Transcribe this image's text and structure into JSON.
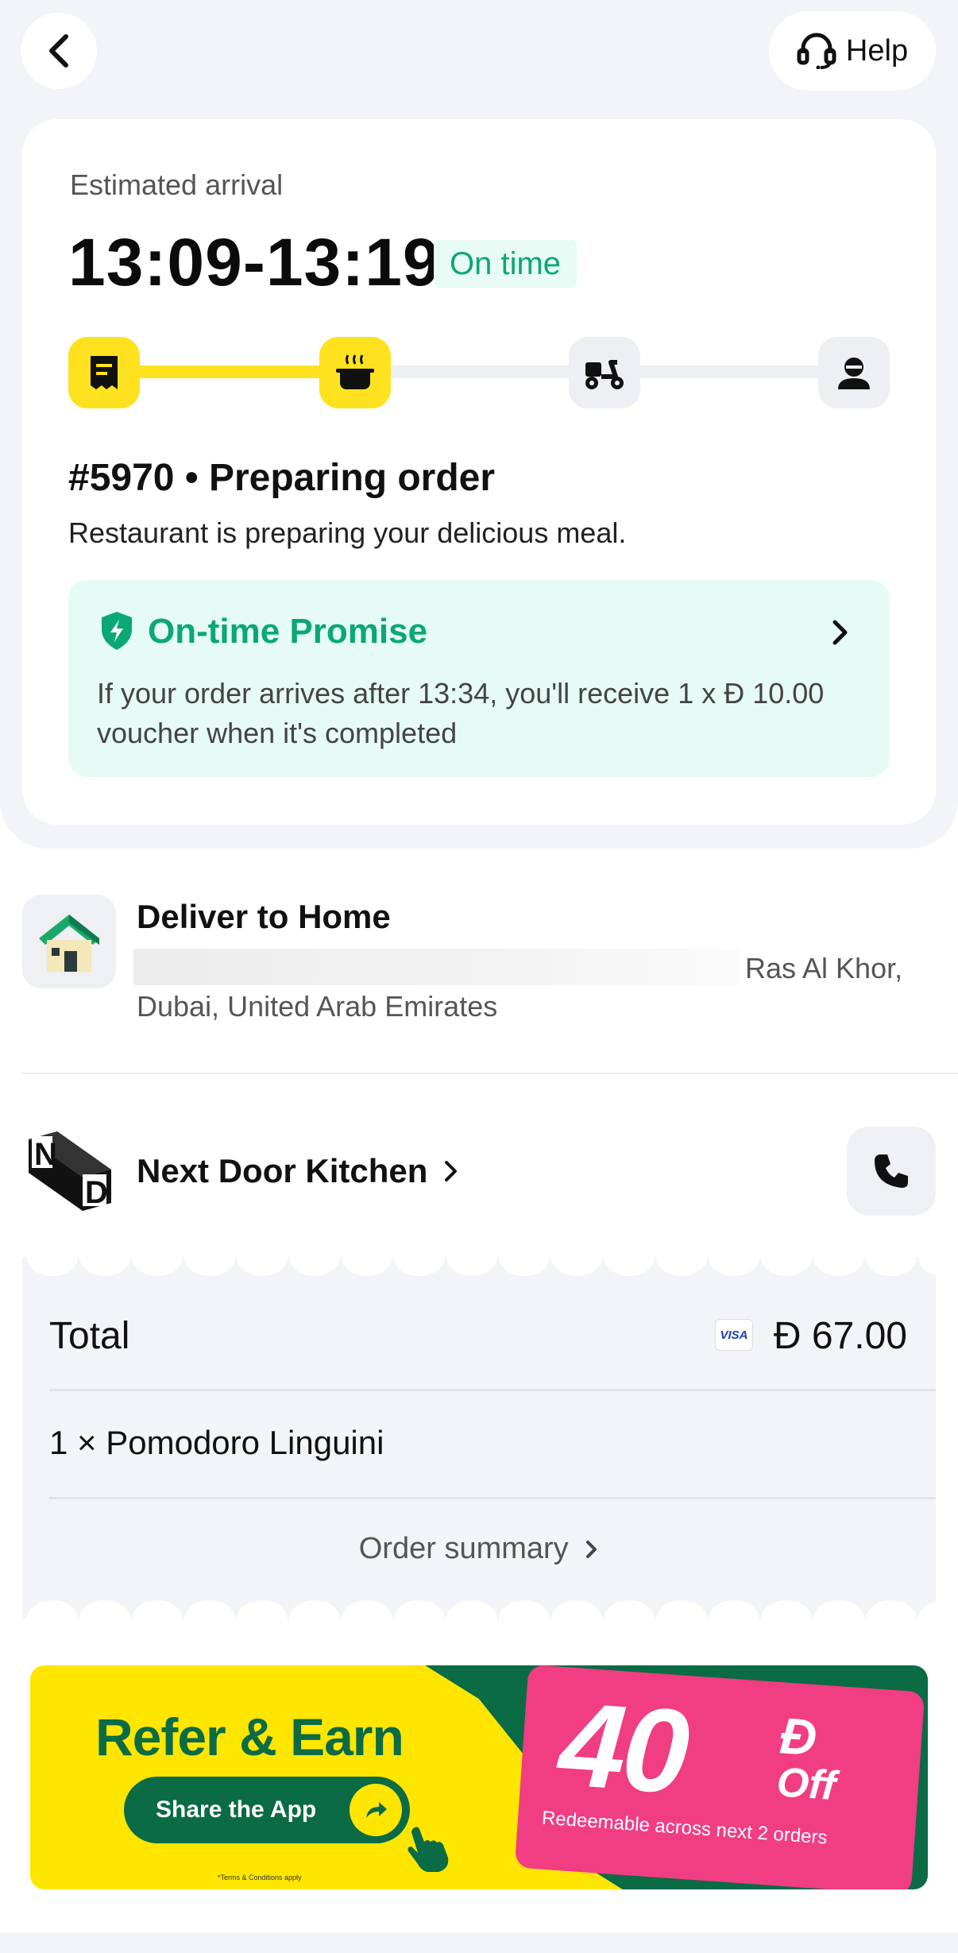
{
  "header": {
    "back_icon": "chevron-left-icon",
    "help_label": "Help",
    "help_icon": "headset-icon"
  },
  "tracking": {
    "estimated_label": "Estimated arrival",
    "eta": "13:09-13:19",
    "status_badge": "On time",
    "progress_fraction": 0.34,
    "steps": [
      {
        "icon": "receipt-icon",
        "state": "done"
      },
      {
        "icon": "cooking-pot-icon",
        "state": "done"
      },
      {
        "icon": "scooter-icon",
        "state": "pending"
      },
      {
        "icon": "person-icon",
        "state": "pending"
      }
    ],
    "order_title": "#5970 • Preparing order",
    "order_desc": "Restaurant is preparing your delicious meal."
  },
  "promise": {
    "title": "On-time Promise",
    "text": "If your order arrives after 13:34, you'll receive 1 x Ð 10.00 voucher when it's completed"
  },
  "delivery": {
    "title": "Deliver to Home",
    "address_line1": "Ras Al Khor,",
    "address_line2": "Dubai, United Arab Emirates"
  },
  "restaurant": {
    "name": "Next Door Kitchen",
    "logo_letters": [
      "N",
      "D"
    ]
  },
  "receipt": {
    "total_label": "Total",
    "payment_method": "VISA",
    "total_value": "Ð 67.00",
    "item": "1 × Pomodoro Linguini",
    "summary_link": "Order summary"
  },
  "banner": {
    "title": "Refer & Earn",
    "share_button": "Share the App",
    "terms": "*Terms & Conditions apply",
    "amount": "40",
    "currency": "Ð",
    "off": "Off",
    "redeem": "Redeemable across next 2 orders"
  },
  "colors": {
    "accent_yellow": "#ffe21f",
    "promise_green": "#0aa874",
    "banner_green": "#0b6b45",
    "ticket_pink": "#f13d82"
  }
}
